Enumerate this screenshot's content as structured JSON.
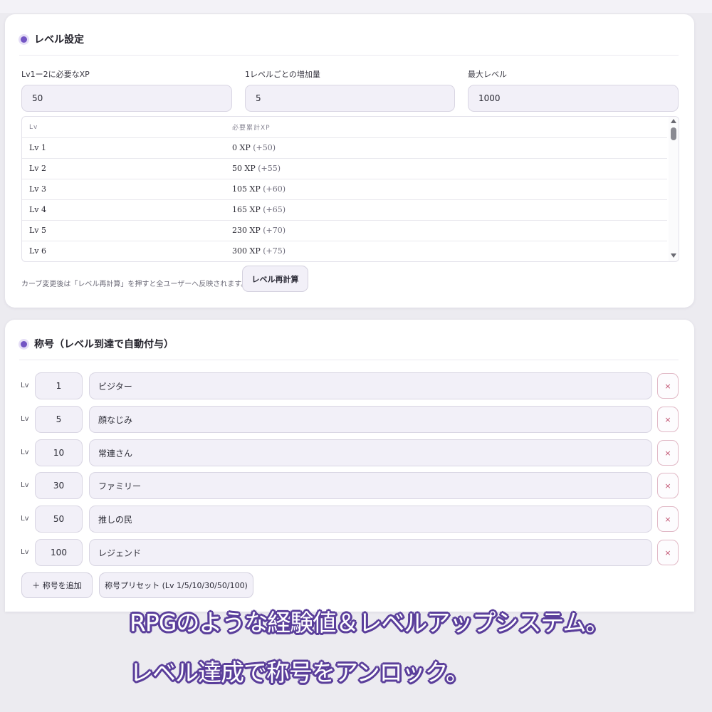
{
  "level_settings": {
    "title": "レベル設定",
    "fields": [
      {
        "label": "Lv1ー2に必要なXP",
        "value": "50"
      },
      {
        "label": "1レベルごとの増加量",
        "value": "5"
      },
      {
        "label": "最大レベル",
        "value": "1000"
      }
    ],
    "table": {
      "headers": [
        "Lv",
        "必要累計XP"
      ],
      "rows": [
        {
          "level": "Lv 1",
          "xp": "0 XP",
          "inc": "(+50)"
        },
        {
          "level": "Lv 2",
          "xp": "50 XP",
          "inc": "(+55)"
        },
        {
          "level": "Lv 3",
          "xp": "105 XP",
          "inc": "(+60)"
        },
        {
          "level": "Lv 4",
          "xp": "165 XP",
          "inc": "(+65)"
        },
        {
          "level": "Lv 5",
          "xp": "230 XP",
          "inc": "(+70)"
        },
        {
          "level": "Lv 6",
          "xp": "300 XP",
          "inc": "(+75)"
        }
      ]
    },
    "note": "カーブ変更後は「レベル再計算」を押すと全ユーザーへ反映されます。",
    "recalc_label": "レベル再計算"
  },
  "titles_section": {
    "title": "称号（レベル到達で自動付与）",
    "lv_prefix": "Lv",
    "delete_icon": "×",
    "rows": [
      {
        "level": "1",
        "name": "ビジター"
      },
      {
        "level": "5",
        "name": "顔なじみ"
      },
      {
        "level": "10",
        "name": "常連さん"
      },
      {
        "level": "30",
        "name": "ファミリー"
      },
      {
        "level": "50",
        "name": "推しの民"
      },
      {
        "level": "100",
        "name": "レジェンド"
      }
    ],
    "add_label": "＋ 称号を追加",
    "preset_label": "称号プリセット (Lv 1/5/10/30/50/100)"
  },
  "caption": {
    "line1": "RPGのような経験値＆レベルアップシステム。",
    "line2": "レベル達成で称号をアンロック。"
  },
  "colors": {
    "accent": "#7355c4",
    "caption_outline": "#5b3f9b",
    "delete": "#c0506f"
  }
}
